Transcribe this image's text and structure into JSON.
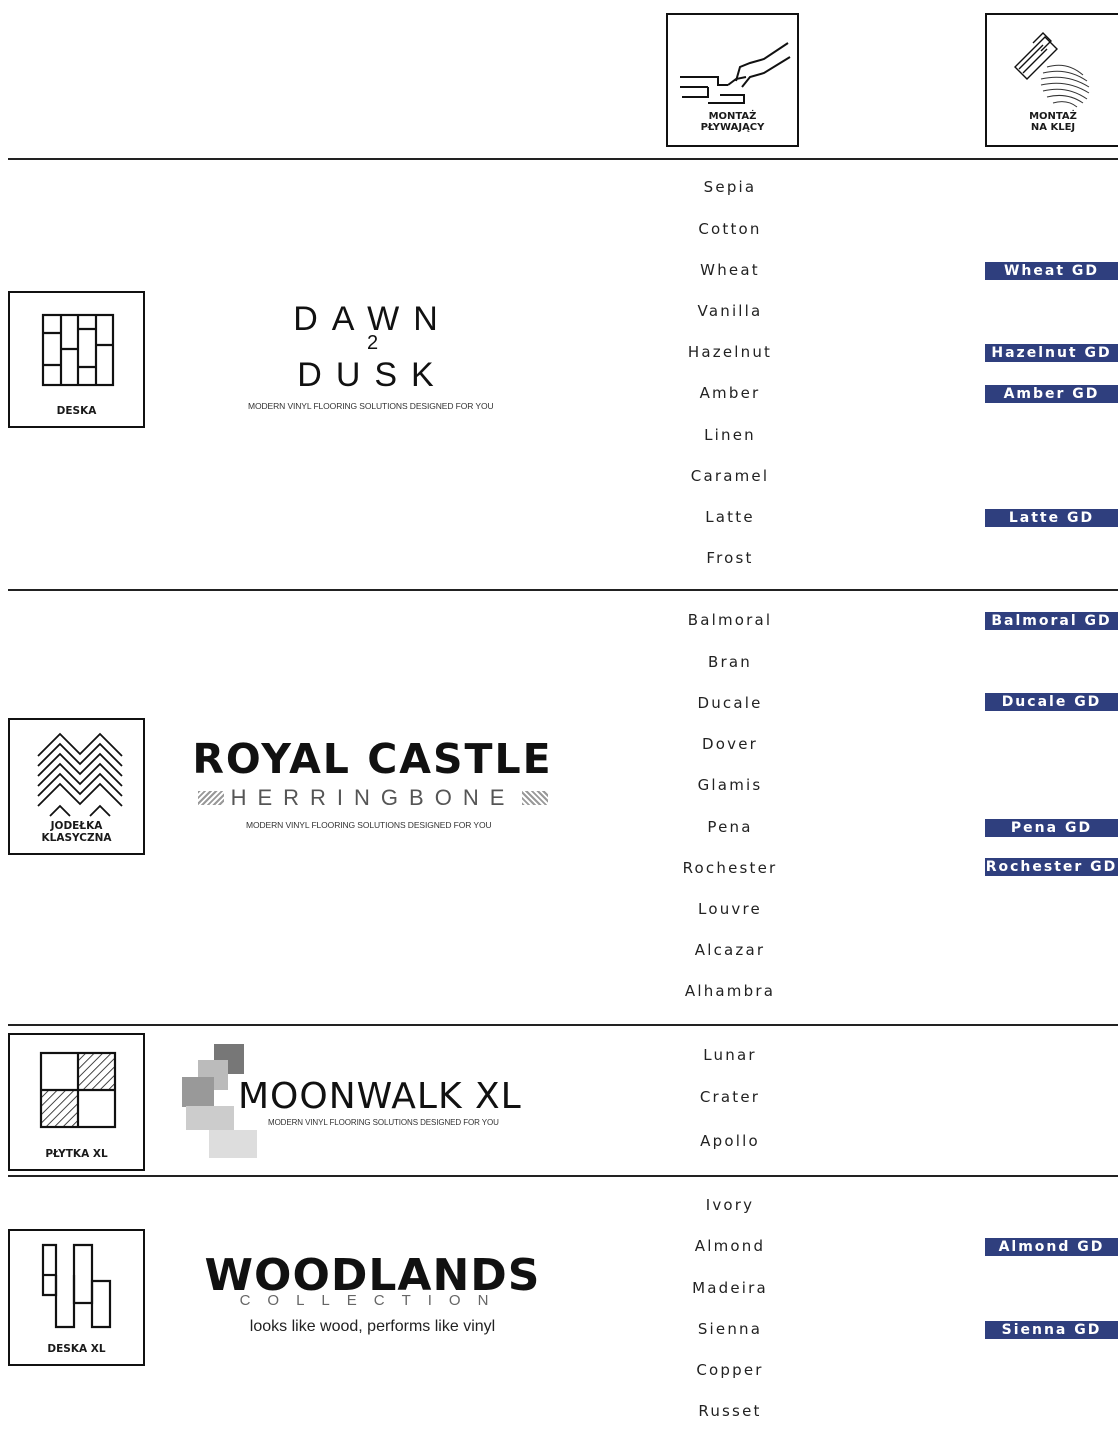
{
  "header": {
    "floating_label_1": "MONTAŻ",
    "floating_label_2": "PŁYWAJĄCY",
    "glue_label_1": "MONTAŻ",
    "glue_label_2": "NA KLEJ"
  },
  "tagline": "MODERN VINYL FLOORING SOLUTIONS DESIGNED FOR YOU",
  "sections": [
    {
      "format": "DESKA",
      "logo": {
        "line1": "DAWN",
        "mid": "2",
        "line2": "DUSK"
      },
      "products": [
        "Sepia",
        "Cotton",
        "Wheat",
        "Vanilla",
        "Hazelnut",
        "Amber",
        "Linen",
        "Caramel",
        "Latte",
        "Frost"
      ],
      "glue": [
        "Wheat GD",
        "Hazelnut GD",
        "Amber GD",
        "Latte GD"
      ]
    },
    {
      "format_1": "JODEŁKA",
      "format_2": "KLASYCZNA",
      "logo": {
        "line1": "ROYAL CASTLE",
        "line2": "HERRINGBONE"
      },
      "products": [
        "Balmoral",
        "Bran",
        "Ducale",
        "Dover",
        "Glamis",
        "Pena",
        "Rochester",
        "Louvre",
        "Alcazar",
        "Alhambra"
      ],
      "glue": [
        "Balmoral GD",
        "Ducale GD",
        "Pena GD",
        "Rochester GD"
      ]
    },
    {
      "format": "PŁYTKA XL",
      "logo": {
        "line1": "MOONWALK XL"
      },
      "products": [
        "Lunar",
        "Crater",
        "Apollo"
      ],
      "glue": []
    },
    {
      "format": "DESKA XL",
      "logo": {
        "line1": "WOODLANDS",
        "line2": "COLLECTION",
        "slogan": "looks like wood, performs like vinyl"
      },
      "products": [
        "Ivory",
        "Almond",
        "Madeira",
        "Sienna",
        "Copper",
        "Russet"
      ],
      "glue": [
        "Almond GD",
        "Sienna GD"
      ]
    }
  ]
}
